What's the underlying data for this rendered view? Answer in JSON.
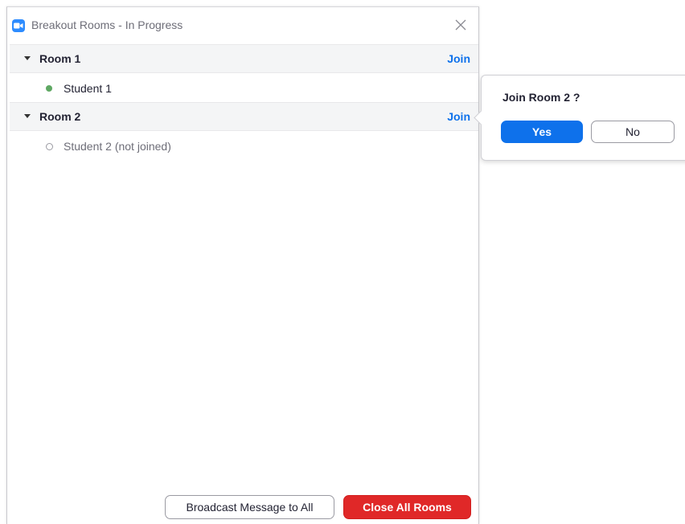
{
  "window": {
    "title": "Breakout Rooms - In Progress",
    "app_icon": "zoom-camera-icon",
    "close_icon": "close-icon"
  },
  "rooms": [
    {
      "name": "Room 1",
      "join_label": "Join",
      "participants": [
        {
          "name": "Student 1",
          "status": "joined"
        }
      ]
    },
    {
      "name": "Room 2",
      "join_label": "Join",
      "participants": [
        {
          "name": "Student 2 (not joined)",
          "status": "not-joined"
        }
      ]
    }
  ],
  "footer": {
    "broadcast_label": "Broadcast Message to All",
    "close_all_label": "Close All Rooms"
  },
  "popover": {
    "title": "Join Room 2 ?",
    "yes_label": "Yes",
    "no_label": "No"
  },
  "colors": {
    "accent": "#0e71eb",
    "danger": "#e02828",
    "joined_dot": "#5fa863",
    "room_header_bg": "#f4f5f6"
  }
}
